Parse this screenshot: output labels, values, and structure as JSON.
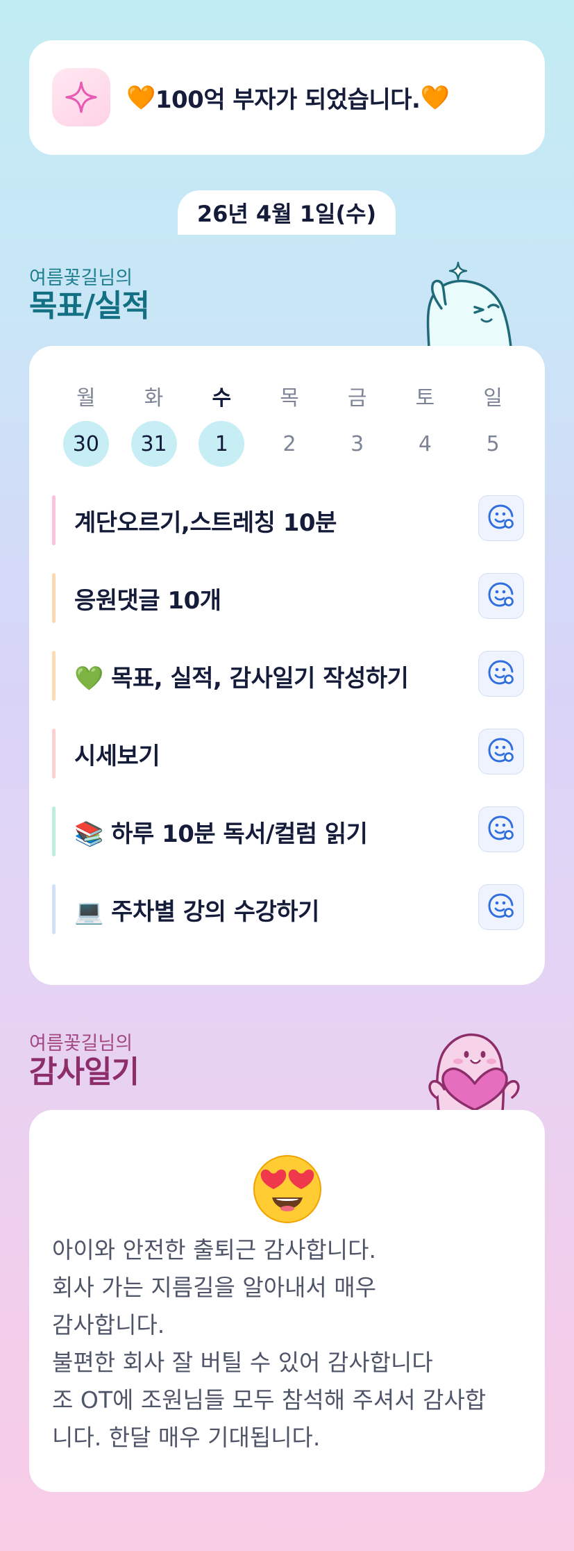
{
  "wish": {
    "text": "100억 부자가 되었습니다.",
    "heart": "🧡"
  },
  "date": "26년 4월 1일(수)",
  "goals_section": {
    "subtitle": "여름꽃길님의",
    "title": "목표/실적"
  },
  "week": {
    "days": [
      {
        "label": "월",
        "date": "30",
        "done": true
      },
      {
        "label": "화",
        "date": "31",
        "done": true
      },
      {
        "label": "수",
        "date": "1",
        "done": true,
        "today": true
      },
      {
        "label": "목",
        "date": "2",
        "done": false
      },
      {
        "label": "금",
        "date": "3",
        "done": false
      },
      {
        "label": "토",
        "date": "4",
        "done": false
      },
      {
        "label": "일",
        "date": "5",
        "done": false
      }
    ]
  },
  "goals": [
    {
      "text": "계단오르기,스트레칭 10분",
      "color": "#f9c3dc"
    },
    {
      "text": "응원댓글 10개",
      "color": "#fbd9b0"
    },
    {
      "text": "💚 목표, 실적, 감사일기 작성하기",
      "color": "#fbdcb5"
    },
    {
      "text": "시세보기",
      "color": "#fbd1d1"
    },
    {
      "text": "📚 하루 10분 독서/컬럼 읽기",
      "color": "#bdeede"
    },
    {
      "text": "💻 주차별 강의 수강하기",
      "color": "#cfe0f8"
    }
  ],
  "gratitude_section": {
    "subtitle": "여름꽃길님의",
    "title": "감사일기"
  },
  "gratitude": {
    "emoji": "😍",
    "lines": [
      "아이와 안전한 출퇴근 감사합니다.",
      "회사 가는 지름길을 알아내서 매우",
      "감사합니다.",
      "불편한 회사 잘 버틸 수 있어 감사합니다",
      "조 OT에 조원님들 모두 참석해 주셔서 감사합",
      "니다. 한달 매우 기대됩니다."
    ]
  },
  "icons": {
    "wish": "sparkle-icon",
    "goal_action": "smiley-add-icon",
    "accent": "#e65bb3",
    "brand_teal": "#127082",
    "brand_plum": "#8d2e6a"
  }
}
